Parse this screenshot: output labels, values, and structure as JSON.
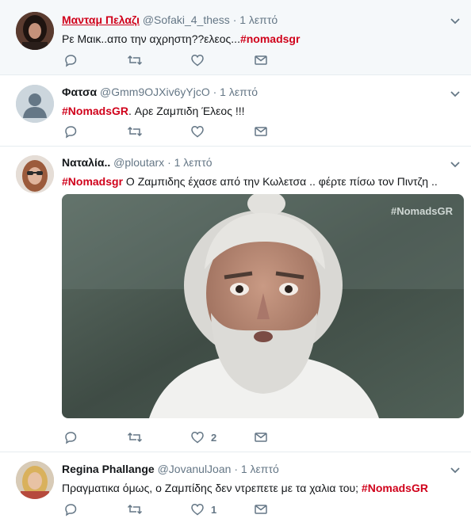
{
  "tweets": [
    {
      "name": "Μανταμ Πελαζι",
      "handle": "@Sofaki_4_thess",
      "sep": "·",
      "time": "1 λεπτό",
      "text_before": "Ρε Μαικ..απο την αχρηστη??ελεος...",
      "hashtag": "#nomadsgr",
      "text_after": "",
      "avatar_icon": "avatar-photo-woman-dark-hair",
      "likes": ""
    },
    {
      "name": "Φατσα",
      "handle": "@Gmm9OJXiv6yYjcO",
      "sep": "·",
      "time": "1 λεπτό",
      "text_before": "",
      "hashtag": "#NomadsGR",
      "text_after": ". Αρε Ζαμπιδη Έλεος  !!!",
      "avatar_icon": "default-avatar-icon",
      "likes": ""
    },
    {
      "name": "Ναταλία..",
      "handle": "@ploutarx",
      "sep": "·",
      "time": "1 λεπτό",
      "text_before": "",
      "hashtag": "#Nomadsgr",
      "text_after": " Ο Ζαμπιδης έχασε από την Κωλετσα .. φέρτε πίσω τον Πιντζη ..",
      "avatar_icon": "avatar-photo-woman-sunglasses",
      "media_watermark": "#NomadsGR",
      "likes": "2"
    },
    {
      "name": "Regina Phallange",
      "handle": "@JovanulJoan",
      "sep": "·",
      "time": "1 λεπτό",
      "text_before": "Πραγματικα όμως, ο Ζαμπίδης δεν ντρεπετε με τα χαλια του;  ",
      "hashtag": "#NomadsGR",
      "text_after": "",
      "avatar_icon": "avatar-photo-woman-blonde",
      "likes": "1"
    }
  ],
  "colors": {
    "hashtag": "#d0021b",
    "meta": "#657786",
    "divider": "#e6ecf0",
    "highlight_bg": "#f5f8fa"
  }
}
